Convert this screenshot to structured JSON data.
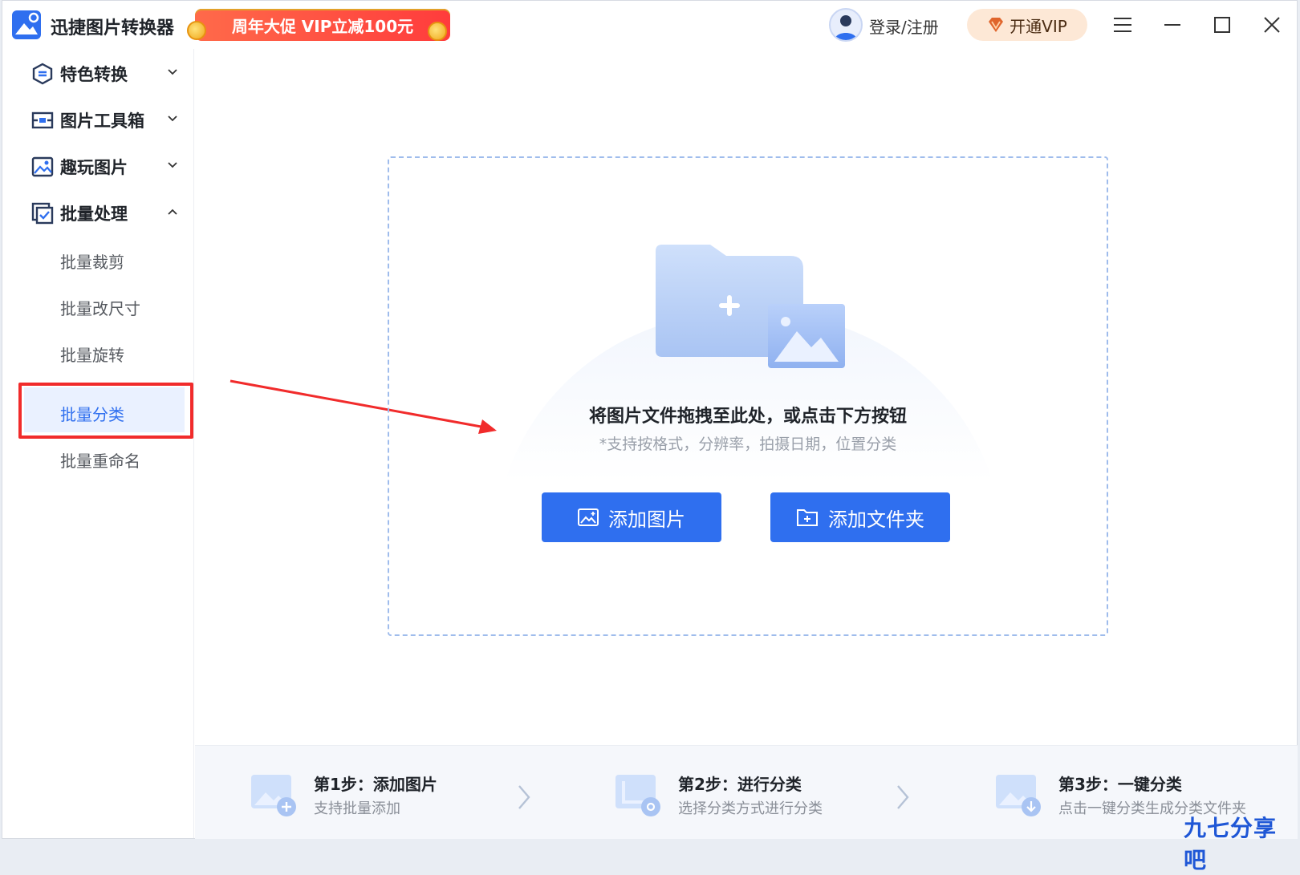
{
  "app": {
    "title": "迅捷图片转换器",
    "promo": "周年大促 VIP立减100元",
    "login": "登录/注册",
    "vip": "开通VIP"
  },
  "sidebar": {
    "groups": [
      {
        "label": "特色转换",
        "expanded": false
      },
      {
        "label": "图片工具箱",
        "expanded": false
      },
      {
        "label": "趣玩图片",
        "expanded": false
      },
      {
        "label": "批量处理",
        "expanded": true
      }
    ],
    "sub_items": [
      "批量裁剪",
      "批量改尺寸",
      "批量旋转",
      "批量分类",
      "批量重命名"
    ],
    "active_item": "批量分类"
  },
  "dropzone": {
    "title": "将图片文件拖拽至此处，或点击下方按钮",
    "subtitle": "*支持按格式，分辨率，拍摄日期，位置分类",
    "add_image": "添加图片",
    "add_folder": "添加文件夹"
  },
  "steps": [
    {
      "title": "第1步：添加图片",
      "desc": "支持批量添加"
    },
    {
      "title": "第2步：进行分类",
      "desc": "选择分类方式进行分类"
    },
    {
      "title": "第3步：一键分类",
      "desc": "点击一键分类生成分类文件夹"
    }
  ],
  "watermark": "九七分享吧",
  "colors": {
    "accent": "#2f6fef",
    "promo": "#ff4a3d",
    "annotation_red": "#f12b2b",
    "vip_bg": "#fde8d6"
  }
}
